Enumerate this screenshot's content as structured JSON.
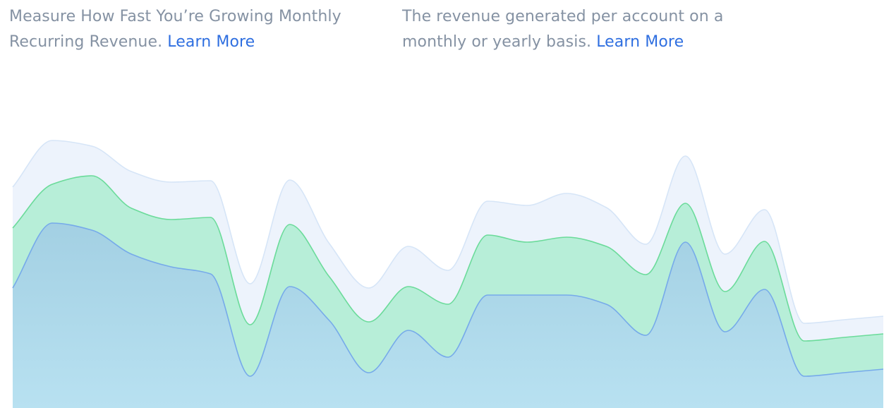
{
  "descriptions": {
    "left": {
      "text": "Measure How Fast You’re Growing Monthly Recurring Revenue.",
      "link": "Learn More"
    },
    "right": {
      "text": "The revenue generated per account on a monthly or yearly basis.",
      "link": "Learn More"
    }
  },
  "colors": {
    "text": "#8592a3",
    "link": "#2f6fe0",
    "series_top_fill": "#edf3fc",
    "series_top_stroke": "#d6e5f7",
    "series_mid_fill": "#b7eed8",
    "series_mid_stroke": "#6bdb9a",
    "series_base_fill_top": "#a3d0e3",
    "series_base_fill_bottom": "#b8e1f1",
    "series_base_stroke": "#76aaea"
  },
  "chart_data": {
    "type": "area",
    "stacked": true,
    "smooth": true,
    "axes_visible": false,
    "grid": false,
    "legend": "none",
    "ylim": [
      0,
      390
    ],
    "x": [
      0,
      1,
      2,
      3,
      4,
      5,
      6,
      7,
      8,
      9,
      10,
      11,
      12,
      13,
      14,
      15,
      16,
      17,
      18,
      19,
      20,
      21,
      22
    ],
    "series": [
      {
        "values": [
          170,
          262,
          252,
          218,
          200,
          190,
          45,
          172,
          124,
          50,
          110,
          72,
          160,
          160,
          160,
          147,
          103,
          235,
          108,
          168,
          45,
          50,
          55
        ]
      },
      {
        "values": [
          85,
          55,
          77,
          65,
          67,
          80,
          73,
          88,
          62,
          72,
          62,
          75,
          85,
          75,
          82,
          82,
          86,
          55,
          57,
          68,
          50,
          50,
          50
        ]
      },
      {
        "values": [
          58,
          62,
          42,
          52,
          53,
          52,
          58,
          63,
          47,
          48,
          57,
          48,
          48,
          52,
          62,
          55,
          43,
          67,
          53,
          45,
          25,
          25,
          25
        ]
      }
    ]
  }
}
